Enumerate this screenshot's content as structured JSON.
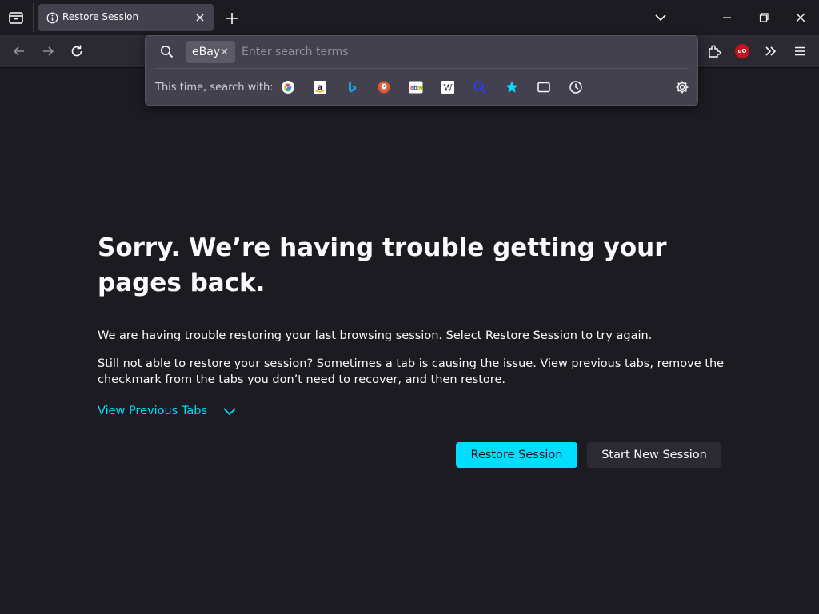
{
  "tab": {
    "title": "Restore Session"
  },
  "search_panel": {
    "engine_chip": "eBay",
    "placeholder": "Enter search terms",
    "oneoff_label": "This time, search with:",
    "engines": [
      "google-icon",
      "amazon-icon",
      "bing-icon",
      "duckduckgo-icon",
      "ebay-icon",
      "wikipedia-icon",
      "search-engine-icon",
      "bookmarks-icon",
      "tabs-icon",
      "history-icon"
    ]
  },
  "content": {
    "heading": "Sorry. We’re having trouble getting your pages back.",
    "para1": "We are having trouble restoring your last browsing session. Select Restore Session to try again.",
    "para2": "Still not able to restore your session? Sometimes a tab is causing the issue. View previous tabs, remove the checkmark from the tabs you don’t need to recover, and then restore.",
    "view_previous": "View Previous Tabs",
    "restore_button": "Restore Session",
    "new_session_button": "Start New Session"
  },
  "colors": {
    "accent": "#00ddff",
    "background": "#1c1b22",
    "toolbar": "#2b2a33",
    "panel": "#42414d"
  }
}
